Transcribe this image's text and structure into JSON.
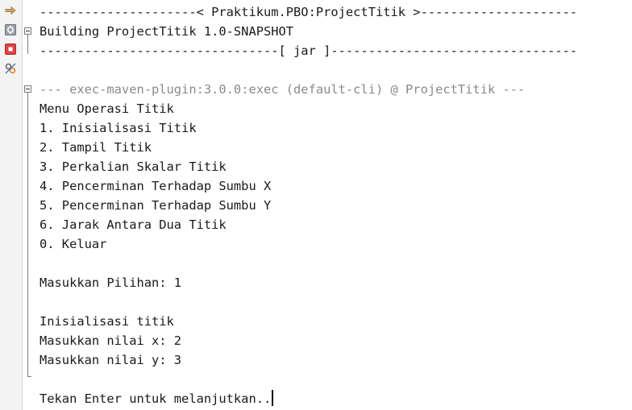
{
  "toolbar": {
    "buttons": [
      {
        "icon": "arrow-right-icon",
        "label": "rerun"
      },
      {
        "icon": "rerun-gear-icon",
        "label": "rerun-with-options"
      },
      {
        "icon": "stop-icon",
        "label": "stop"
      },
      {
        "icon": "settings-icon",
        "label": "settings"
      }
    ]
  },
  "console": {
    "header_line": "---------------------< Praktikum.PBO:ProjectTitik >---------------------",
    "building_line": "Building ProjectTitik 1.0-SNAPSHOT",
    "jar_line": "--------------------------------[ jar ]---------------------------------",
    "blank1": "",
    "plugin_line": "--- exec-maven-plugin:3.0.0:exec (default-cli) @ ProjectTitik ---",
    "menu_title": "Menu Operasi Titik",
    "menu_items": [
      "1. Inisialisasi Titik",
      "2. Tampil Titik",
      "3. Perkalian Skalar Titik",
      "4. Pencerminan Terhadap Sumbu X",
      "5. Pencerminan Terhadap Sumbu Y",
      "6. Jarak Antara Dua Titik",
      "0. Keluar"
    ],
    "blank2": "",
    "choice_line": "Masukkan Pilihan: 1",
    "blank3": "",
    "init_line": "Inisialisasi titik",
    "x_line": "Masukkan nilai x: 2",
    "y_line": "Masukkan nilai y: 3",
    "blank4": "",
    "prompt_line": "Tekan Enter untuk melanjutkan.."
  },
  "colors": {
    "text": "#1a1a1a",
    "plugin_text": "#8a8a8a",
    "toolbar_bg": "#f3f3f3",
    "stop_red": "#e04343",
    "arrow_orange": "#d9822b"
  }
}
